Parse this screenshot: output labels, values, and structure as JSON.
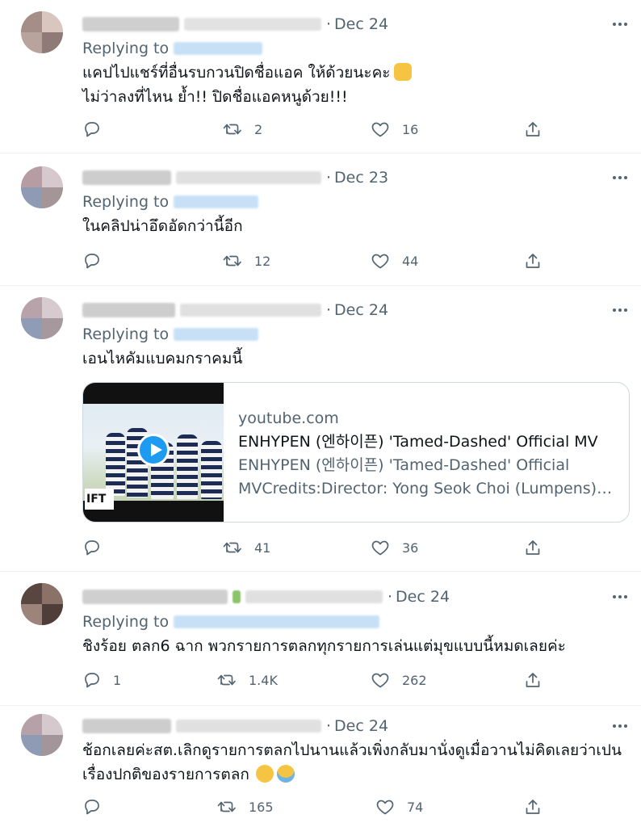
{
  "tweets": [
    {
      "date": "Dec 24",
      "replying_label": "Replying to",
      "lines": [
        "แคปไปแชร์ที่อื่นรบกวนปิดชื่อแอค ให้ด้วยนะคะ",
        "ไม่ว่าลงที่ไหน ย้ำ!! ปิดชื่อแอคหนูด้วย!!!"
      ],
      "line_emoji": [
        "folded-hands-icon",
        ""
      ],
      "reply_count": "",
      "retweet_count": "2",
      "like_count": "16"
    },
    {
      "date": "Dec 23",
      "replying_label": "Replying to",
      "lines": [
        "ในคลิปน่าอึดอัดกว่านี้อีก"
      ],
      "reply_count": "",
      "retweet_count": "12",
      "like_count": "44"
    },
    {
      "date": "Dec 24",
      "replying_label": "Replying to",
      "lines": [
        "เอนไหคัมแบคมกราคมนี้"
      ],
      "card": {
        "domain": "youtube.com",
        "title": "ENHYPEN (엔하이픈) 'Tamed-Dashed' Official MV",
        "description_line1": "ENHYPEN (엔하이픈) 'Tamed-Dashed' Official",
        "description_line2": "MVCredits:Director: Yong Seok Choi (Lumpens)Creative",
        "thumb_caption": "IFT"
      },
      "reply_count": "",
      "retweet_count": "41",
      "like_count": "36"
    },
    {
      "date": "Dec 24",
      "replying_label": "Replying to",
      "lines": [
        "ชิงร้อย ตลก6 ฉาก พวกรายการตลกทุกรายการเล่นแต่มุขแบบนี้หมดเลยค่ะ"
      ],
      "reply_count": "1",
      "retweet_count": "1.4K",
      "like_count": "262"
    },
    {
      "date": "Dec 24",
      "lines": [
        "ช้อกเลยค่ะสต.เลิกดูรายการตลกไปนานแล้วเพิ่งกลับมานั่งดูเมื่อวานไม่คิดเลยว่าเปน",
        "เรื่องปกติของรายการตลก"
      ],
      "line_emoji": [
        "",
        "frowning-face-icon crying-face-icon"
      ],
      "reply_count": "",
      "retweet_count": "165",
      "like_count": "74"
    }
  ],
  "colors": {
    "text": "#0f1419",
    "secondary": "#536471",
    "divider": "#eff3f4",
    "card_border": "#cfd9de",
    "play_button": "#1d9bf0"
  }
}
